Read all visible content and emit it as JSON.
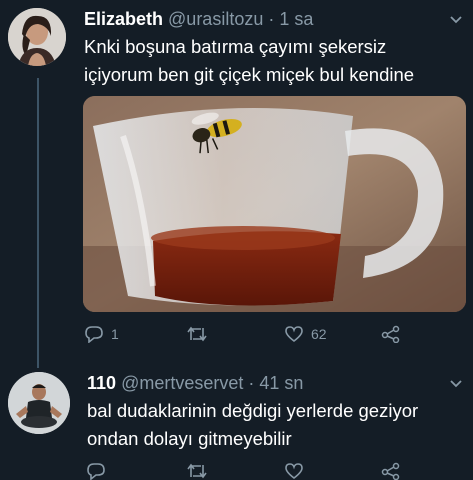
{
  "tweet1": {
    "display_name": "Elizabeth",
    "handle": "@urasiltozu",
    "separator": "·",
    "time": "1 sa",
    "text_line1": "Knki boşuna batırma çayımı şekersiz",
    "text_line2": "içiyorum ben git çiçek miçek bul kendine",
    "media_icon": "wasp-on-tea-glass-photo",
    "actions": {
      "reply_count": "1",
      "retweet_count": "",
      "like_count": "62"
    }
  },
  "tweet2": {
    "display_name": "110",
    "handle": "@mertveservet",
    "separator": "·",
    "time": "41 sn",
    "text_line1": "bal dudaklarinin değdigi yerlerde geziyor",
    "text_line2": "ondan dolayı gitmeyebilir"
  },
  "icons": [
    "chevron-down-icon",
    "reply-icon",
    "retweet-icon",
    "like-icon",
    "share-icon"
  ],
  "colors": {
    "background": "#141d26",
    "text": "#ffffff",
    "muted": "#8899a6",
    "thread_line": "#3d5466"
  }
}
